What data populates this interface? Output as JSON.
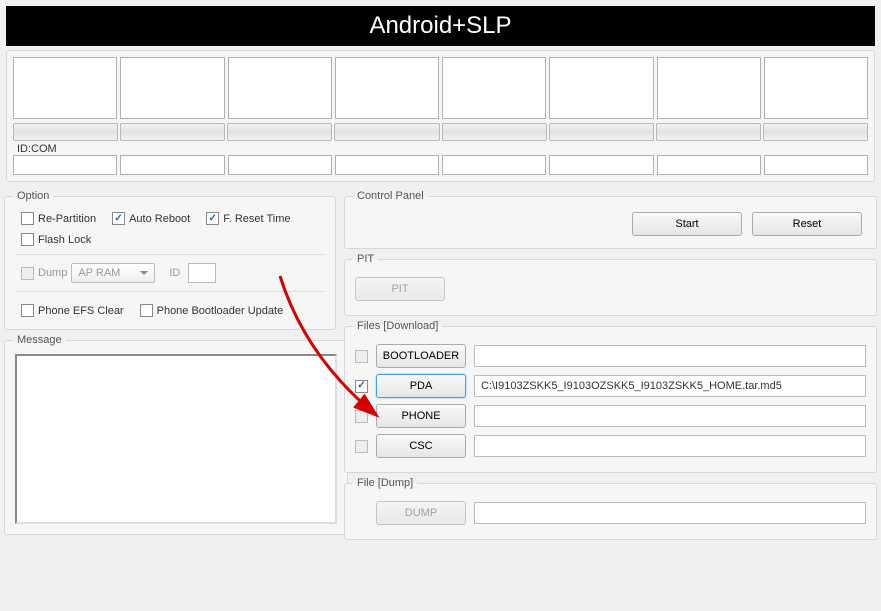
{
  "title": "Android+SLP",
  "idcom_label": "ID:COM",
  "option": {
    "legend": "Option",
    "re_partition": "Re-Partition",
    "auto_reboot": "Auto Reboot",
    "freset_time": "F. Reset Time",
    "flash_lock": "Flash Lock",
    "dump": "Dump",
    "dump_target": "AP RAM",
    "id_label": "ID",
    "efs_clear": "Phone EFS Clear",
    "bootloader_update": "Phone Bootloader Update"
  },
  "checked": {
    "re_partition": false,
    "auto_reboot": true,
    "freset_time": true,
    "flash_lock": false,
    "dump": false,
    "efs_clear": false,
    "bootloader_update": false,
    "bootloader_file": false,
    "pda_file": true,
    "phone_file": false,
    "csc_file": false
  },
  "message": {
    "legend": "Message"
  },
  "control_panel": {
    "legend": "Control Panel",
    "start": "Start",
    "reset": "Reset"
  },
  "pit": {
    "legend": "PIT",
    "button": "PIT",
    "path": ""
  },
  "files": {
    "legend": "Files [Download]",
    "bootloader": {
      "button": "BOOTLOADER",
      "path": ""
    },
    "pda": {
      "button": "PDA",
      "path": "C:\\I9103ZSKK5_I9103OZSKK5_I9103ZSKK5_HOME.tar.md5"
    },
    "phone": {
      "button": "PHONE",
      "path": ""
    },
    "csc": {
      "button": "CSC",
      "path": ""
    }
  },
  "filedump": {
    "legend": "File [Dump]",
    "button": "DUMP",
    "path": ""
  }
}
